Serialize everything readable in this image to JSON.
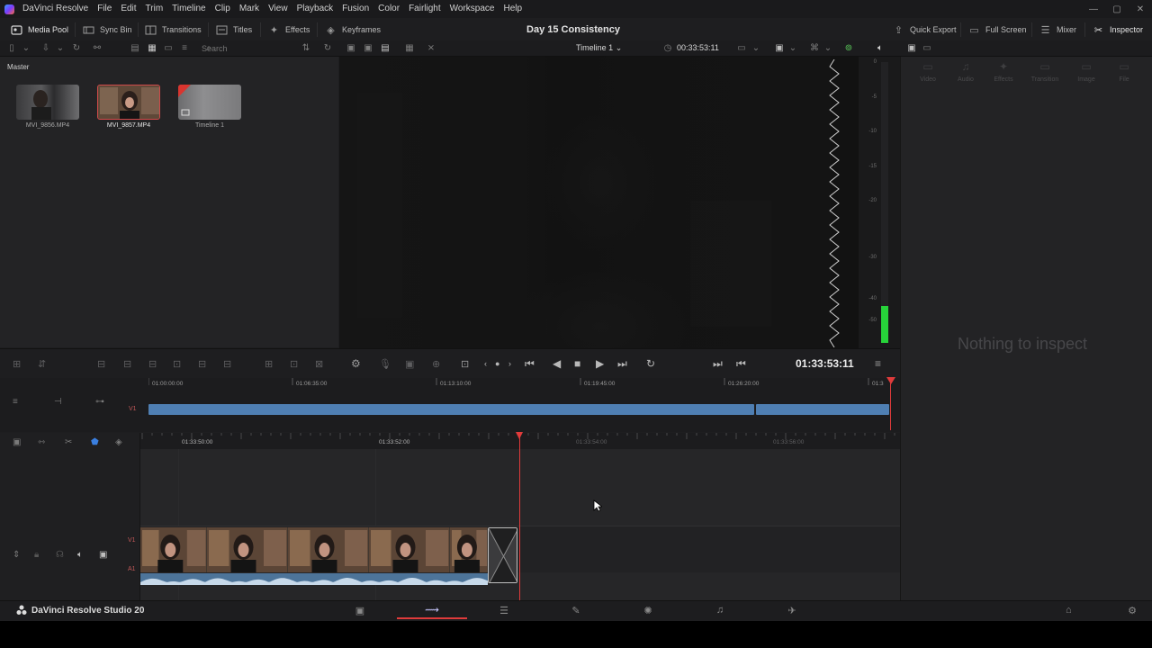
{
  "app_name": "DaVinci Resolve",
  "menu": [
    "File",
    "Edit",
    "Trim",
    "Timeline",
    "Clip",
    "Mark",
    "View",
    "Playback",
    "Fusion",
    "Color",
    "Fairlight",
    "Workspace",
    "Help"
  ],
  "toolbar": {
    "media_pool": "Media Pool",
    "sync_bin": "Sync Bin",
    "transitions": "Transitions",
    "titles": "Titles",
    "effects": "Effects",
    "keyframes": "Keyframes",
    "quick_export": "Quick Export",
    "full_screen": "Full Screen",
    "mixer": "Mixer",
    "inspector": "Inspector"
  },
  "project_title": "Day 15 Consistency",
  "search": {
    "placeholder": "Search"
  },
  "viewer": {
    "timeline_name": "Timeline 1",
    "timecode": "00:33:53:11"
  },
  "media_pool": {
    "breadcrumb": "Master",
    "clips": [
      {
        "name": "MVI_9856.MP4",
        "selected": false
      },
      {
        "name": "MVI_9857.MP4",
        "selected": true
      },
      {
        "name": "Timeline 1",
        "selected": false
      }
    ]
  },
  "meter": {
    "labels": [
      "0",
      "-5",
      "-10",
      "-15",
      "-20",
      "-30",
      "-40",
      "-50"
    ],
    "level_fraction": 0.13,
    "color": "#27d33a"
  },
  "inspector": {
    "tabs": [
      "Video",
      "Audio",
      "Effects",
      "Transition",
      "Image",
      "File"
    ],
    "empty_message": "Nothing to inspect"
  },
  "transport": {
    "timecode": "01:33:53:11"
  },
  "upper_ruler": [
    "01:00:00:00",
    "01:06:35:00",
    "01:13:10:00",
    "01:19:45:00",
    "01:26:20:00",
    "01:3"
  ],
  "lower_ruler": [
    "01:33:50:00",
    "01:33:52:00",
    "01:33:54:00",
    "01:33:56:00"
  ],
  "tracks": {
    "video": "V1",
    "audio": "A1"
  },
  "colors": {
    "accent_red": "#e03b3b",
    "clip_blue": "#4f7fb3",
    "audio_blue": "#4d7499"
  },
  "bottom": {
    "brand": "DaVinci Resolve Studio 20"
  }
}
